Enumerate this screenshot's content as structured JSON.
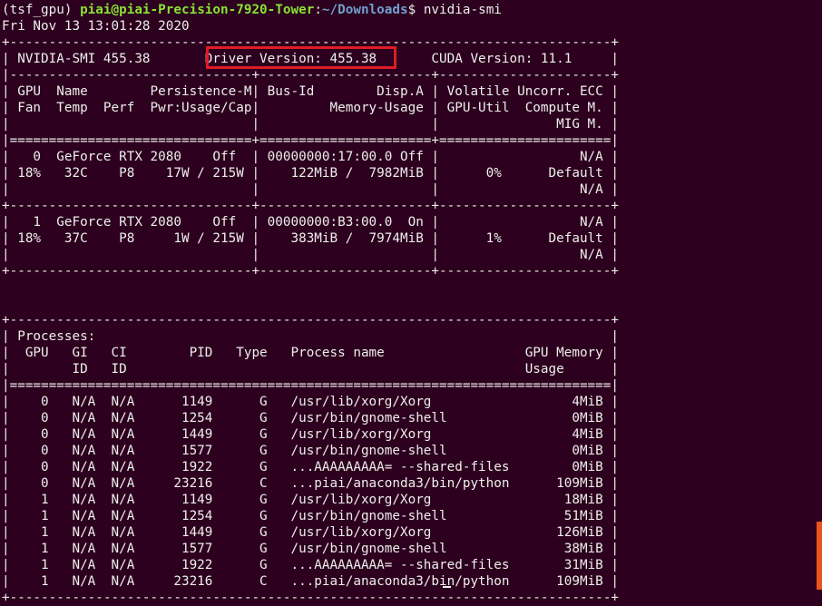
{
  "prompt": {
    "env": "(tsf_gpu) ",
    "user_host": "piai@piai-Precision-7920-Tower",
    "sep": ":",
    "path": "~/Downloads",
    "symbol": "$ ",
    "command": "nvidia-smi"
  },
  "timestamp": "Fri Nov 13 13:01:28 2020",
  "output_lines": [
    "+-----------------------------------------------------------------------------+",
    "| NVIDIA-SMI 455.38       Driver Version: 455.38       CUDA Version: 11.1     |",
    "|-------------------------------+----------------------+----------------------+",
    "| GPU  Name        Persistence-M| Bus-Id        Disp.A | Volatile Uncorr. ECC |",
    "| Fan  Temp  Perf  Pwr:Usage/Cap|         Memory-Usage | GPU-Util  Compute M. |",
    "|                               |                      |               MIG M. |",
    "|===============================+======================+======================|",
    "|   0  GeForce RTX 2080    Off  | 00000000:17:00.0 Off |                  N/A |",
    "| 18%   32C    P8    17W / 215W |    122MiB /  7982MiB |      0%      Default |",
    "|                               |                      |                  N/A |",
    "+-------------------------------+----------------------+----------------------+",
    "|   1  GeForce RTX 2080    Off  | 00000000:B3:00.0  On |                  N/A |",
    "| 18%   37C    P8     1W / 215W |    383MiB /  7974MiB |      1%      Default |",
    "|                               |                      |                  N/A |",
    "+-------------------------------+----------------------+----------------------+",
    "",
    "",
    "+-----------------------------------------------------------------------------+",
    "| Processes:                                                                  |",
    "|  GPU   GI   CI        PID   Type   Process name                  GPU Memory |",
    "|        ID   ID                                                   Usage      |",
    "|=============================================================================|",
    "|    0   N/A  N/A      1149      G   /usr/lib/xorg/Xorg                  4MiB |",
    "|    0   N/A  N/A      1254      G   /usr/bin/gnome-shell                0MiB |",
    "|    0   N/A  N/A      1449      G   /usr/lib/xorg/Xorg                  4MiB |",
    "|    0   N/A  N/A      1577      G   /usr/bin/gnome-shell                0MiB |",
    "|    0   N/A  N/A      1922      G   ...AAAAAAAAA= --shared-files        0MiB |",
    "|    0   N/A  N/A     23216      C   ...piai/anaconda3/bin/python      109MiB |",
    "|    1   N/A  N/A      1149      G   /usr/lib/xorg/Xorg                 18MiB |",
    "|    1   N/A  N/A      1254      G   /usr/bin/gnome-shell               51MiB |",
    "|    1   N/A  N/A      1449      G   /usr/lib/xorg/Xorg                126MiB |",
    "|    1   N/A  N/A      1577      G   /usr/bin/gnome-shell               38MiB |",
    "|    1   N/A  N/A      1922      G   ...AAAAAAAAA= --shared-files       31MiB |",
    "|    1   N/A  N/A     23216      C   ...piai/anaconda3/bin/python      109MiB |",
    "+-----------------------------------------------------------------------------+"
  ],
  "colors": {
    "background": "#2c001e",
    "text": "#eeeeec",
    "user_host": "#8ae234",
    "path": "#729fcf",
    "highlight": "#e01b24",
    "scrollbar": "#e95420"
  }
}
